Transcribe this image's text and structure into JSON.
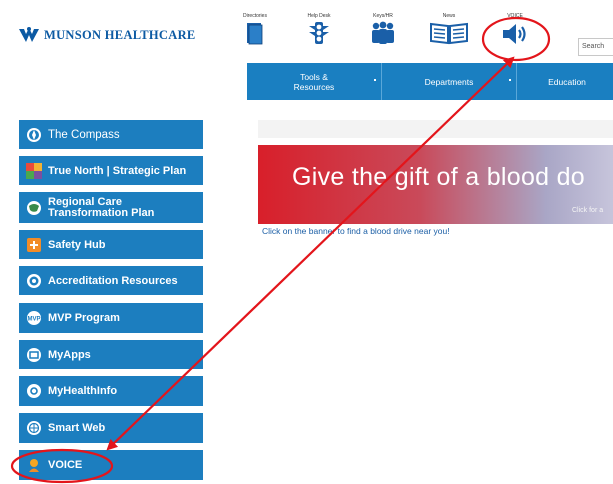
{
  "logo": {
    "text": "Munson Healthcare"
  },
  "top_icons": [
    {
      "label": "Directories",
      "icon": "book-icon"
    },
    {
      "label": "Help Desk",
      "icon": "traffic-light-icon"
    },
    {
      "label": "Keys/HR",
      "icon": "people-icon"
    },
    {
      "label": "News",
      "icon": "newspaper-icon"
    },
    {
      "label": "VOICE",
      "icon": "speaker-icon"
    }
  ],
  "search": {
    "placeholder": "Search"
  },
  "nav": {
    "items": [
      {
        "label": "Tools & Resources"
      },
      {
        "label": "Departments"
      },
      {
        "label": "Education"
      }
    ]
  },
  "sidebar": {
    "items": [
      {
        "label": "The Compass",
        "icon": "compass-icon"
      },
      {
        "label": "True North | Strategic Plan",
        "icon": "mosaic-icon"
      },
      {
        "label": "Regional Care Transformation Plan",
        "icon": "globe-icon"
      },
      {
        "label": "Safety Hub",
        "icon": "safety-icon"
      },
      {
        "label": "Accreditation Resources",
        "icon": "target-icon"
      },
      {
        "label": "MVP Program",
        "icon": "mvp-icon"
      },
      {
        "label": "MyApps",
        "icon": "window-icon"
      },
      {
        "label": "MyHealthInfo",
        "icon": "health-icon"
      },
      {
        "label": "Smart Web",
        "icon": "web-icon"
      },
      {
        "label": "VOICE",
        "icon": "voice-icon"
      }
    ]
  },
  "banner": {
    "headline": "Give the gift of a blood do",
    "sub": "Click for a",
    "caption": "Click on the banner to find a blood drive near you!"
  },
  "annotation": {
    "color": "#e3151b"
  }
}
